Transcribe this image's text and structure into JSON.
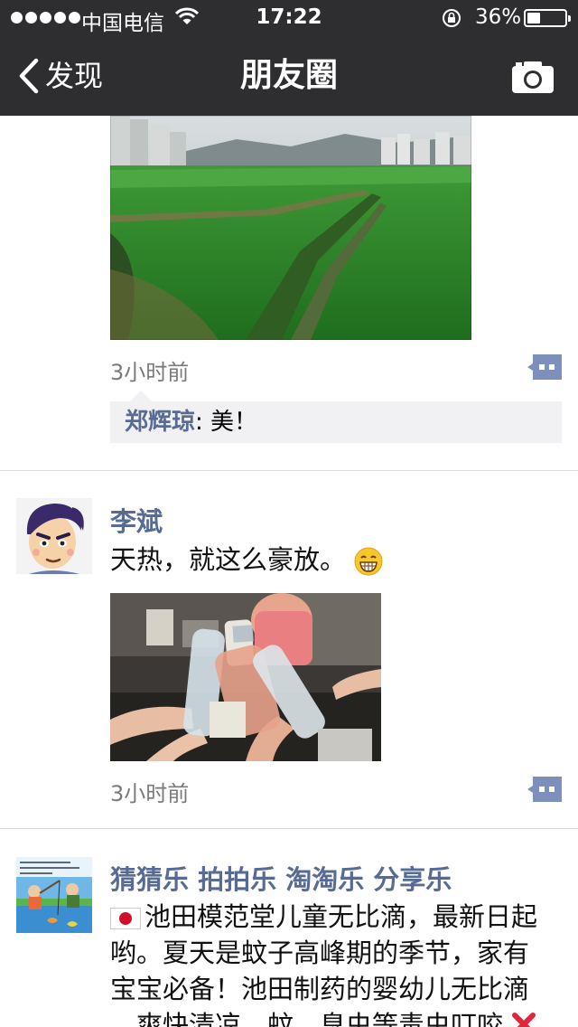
{
  "status_bar": {
    "carrier": "中国电信",
    "time": "17:22",
    "battery_percent": "36%",
    "battery_level": 0.36
  },
  "nav": {
    "back_label": "发现",
    "title": "朋友圈"
  },
  "posts": [
    {
      "timestamp": "3小时前",
      "comments": [
        {
          "author": "郑辉琼",
          "text": ": 美！"
        }
      ]
    },
    {
      "author": "李斌",
      "text": "天热，就这么豪放。",
      "timestamp": "3小时前"
    },
    {
      "author": "猜猜乐 拍拍乐 淘淘乐 分享乐",
      "text_lines": [
        "池田模范堂儿童无比滴，最新日起",
        "哟。夏天是蚊子高峰期的季节，家有",
        "宝宝必备！池田制药的婴幼儿无比滴",
        "，爽快清凉，蚊、臭虫等毒虫叮咬"
      ]
    }
  ],
  "colors": {
    "nav_background": "#2e2e30",
    "name_blue": "#576b95",
    "comment_bg": "#f1f1f3",
    "comment_icon": "#7d8fbb"
  },
  "icons": [
    "wifi-icon",
    "lock-rotation-icon",
    "battery-icon",
    "back-chevron-icon",
    "camera-icon",
    "comment-icon",
    "grin-emoji-icon",
    "japan-flag-icon",
    "cross-mark-icon"
  ]
}
